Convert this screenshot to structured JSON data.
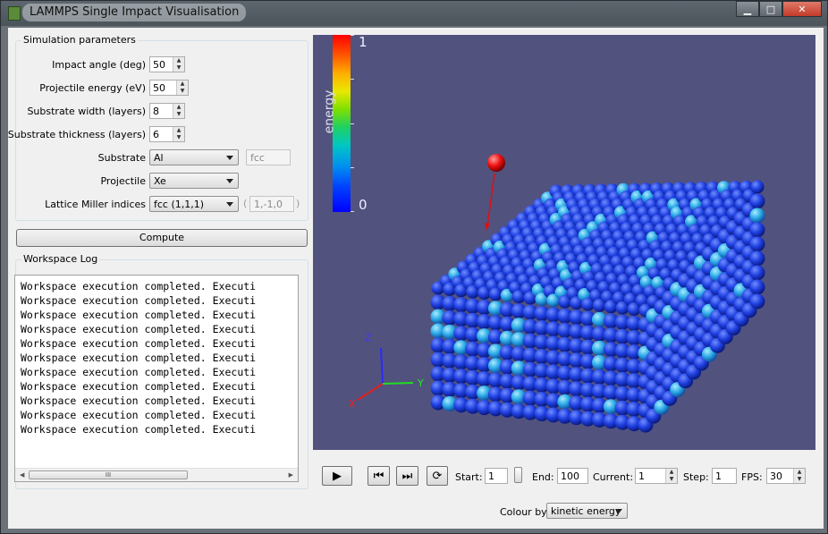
{
  "window": {
    "title": "LAMMPS Single Impact Visualisation",
    "buttons": {
      "minimize": "▁",
      "maximize": "□",
      "close": "✕"
    }
  },
  "params": {
    "title": "Simulation parameters",
    "impact_angle": {
      "label": "Impact angle (deg)",
      "value": "50"
    },
    "projectile_energy": {
      "label": "Projectile energy (eV)",
      "value": "50"
    },
    "substrate_width": {
      "label": "Substrate width (layers)",
      "value": "8"
    },
    "substrate_thickness": {
      "label": "Substrate thickness (layers)",
      "value": "6"
    },
    "substrate": {
      "label": "Substrate",
      "value": "Al",
      "lattice": "fcc"
    },
    "projectile": {
      "label": "Projectile",
      "value": "Xe"
    },
    "miller": {
      "label": "Lattice Miller indices",
      "value": "fcc (1,1,1)",
      "vector": "1,-1,0",
      "paren_open": "(",
      "paren_close": ")"
    }
  },
  "compute_label": "Compute",
  "log": {
    "title": "Workspace Log",
    "lines": [
      "Workspace execution completed. Executi",
      "Workspace execution completed. Executi",
      "Workspace execution completed. Executi",
      "Workspace execution completed. Executi",
      "Workspace execution completed. Executi",
      "Workspace execution completed. Executi",
      "Workspace execution completed. Executi",
      "Workspace execution completed. Executi",
      "Workspace execution completed. Executi",
      "Workspace execution completed. Executi",
      "Workspace execution completed. Executi"
    ],
    "scroll_left": "◀",
    "scroll_right": "▶",
    "scroll_grip": "III"
  },
  "viewport": {
    "colorbar": {
      "title": "energy",
      "max": "1",
      "min": "0"
    },
    "axes": {
      "x": "X",
      "y": "Y",
      "z": "Z"
    },
    "colors": {
      "background": "#52527e",
      "atoms": "#1f3fe0",
      "projectile": "#ee1111"
    }
  },
  "controls": {
    "play_icon": "▶",
    "first_icon": "⏮",
    "last_icon": "⏭",
    "rotate_icon": "⟳",
    "start_label": "Start:",
    "start_value": "1",
    "end_label": "End:",
    "end_value": "100",
    "current_label": "Current:",
    "current_value": "1",
    "step_label": "Step:",
    "step_value": "1",
    "fps_label": "FPS:",
    "fps_value": "30",
    "colour_by_label": "Colour by",
    "colour_by_value": "kinetic energy"
  }
}
